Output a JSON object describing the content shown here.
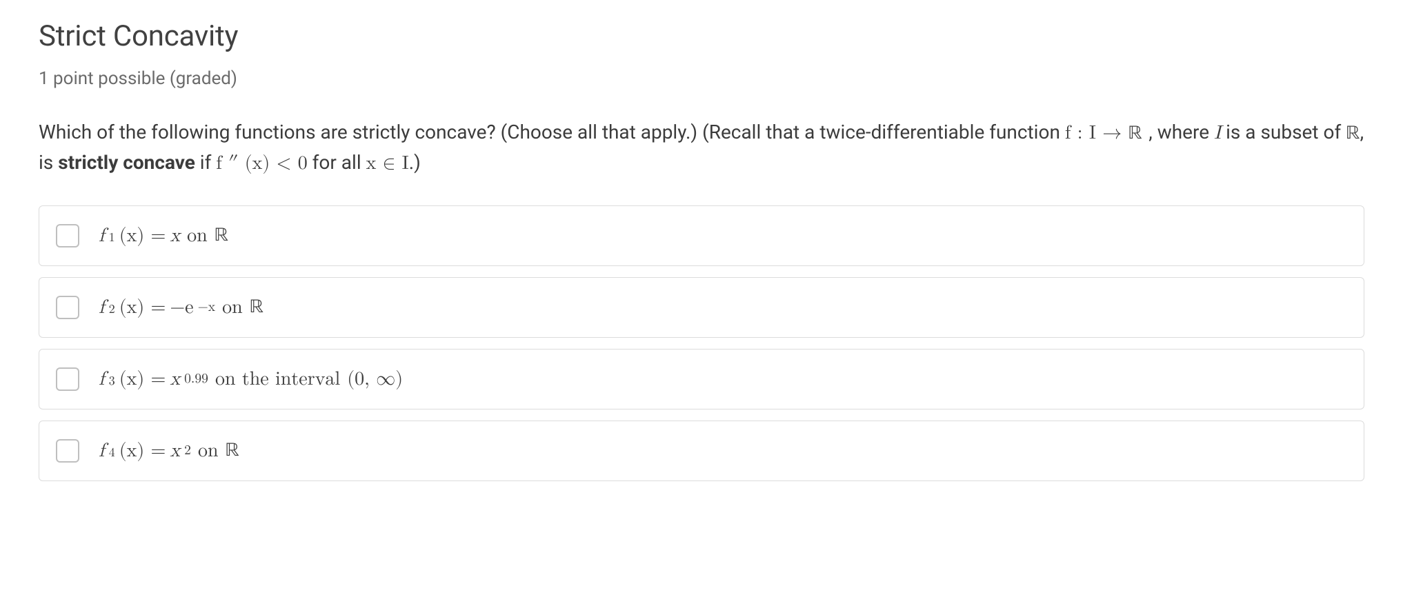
{
  "title": "Strict Concavity",
  "points": "1 point possible (graded)",
  "stem": {
    "lead": "Which of the following functions are strictly concave? (Choose all that apply.) (Recall that a twice-differentiable function ",
    "fn_map_prefix": "f : I → ",
    "real_symbol": "ℝ",
    "where_clause": ", where ",
    "I": "I",
    "is_subset": " is a subset of ",
    "tail1": ", is ",
    "strict_conc": "strictly concave",
    "if_text": " if ",
    "cond": "f ″ (x) < 0",
    "forall": " for all ",
    "x_in_I": "x ∈ I",
    "closing": ".)"
  },
  "options": [
    {
      "fnlabel": "f",
      "sub": "1",
      "open": " (x) = ",
      "body": "x",
      "suffix": " on ",
      "domain": "ℝ"
    },
    {
      "fnlabel": "f",
      "sub": "2",
      "open": " (x) = ",
      "prefix": "−e",
      "exp": "−x",
      "suffix": " on ",
      "domain": "ℝ"
    },
    {
      "fnlabel": "f",
      "sub": "3",
      "open": " (x) = ",
      "base": "x",
      "exp": "0.99",
      "suffix": " on the interval ",
      "domain": "(0, ∞)"
    },
    {
      "fnlabel": "f",
      "sub": "4",
      "open": " (x) = ",
      "base": "x",
      "exp": "2",
      "suffix": " on ",
      "domain": "ℝ"
    }
  ]
}
